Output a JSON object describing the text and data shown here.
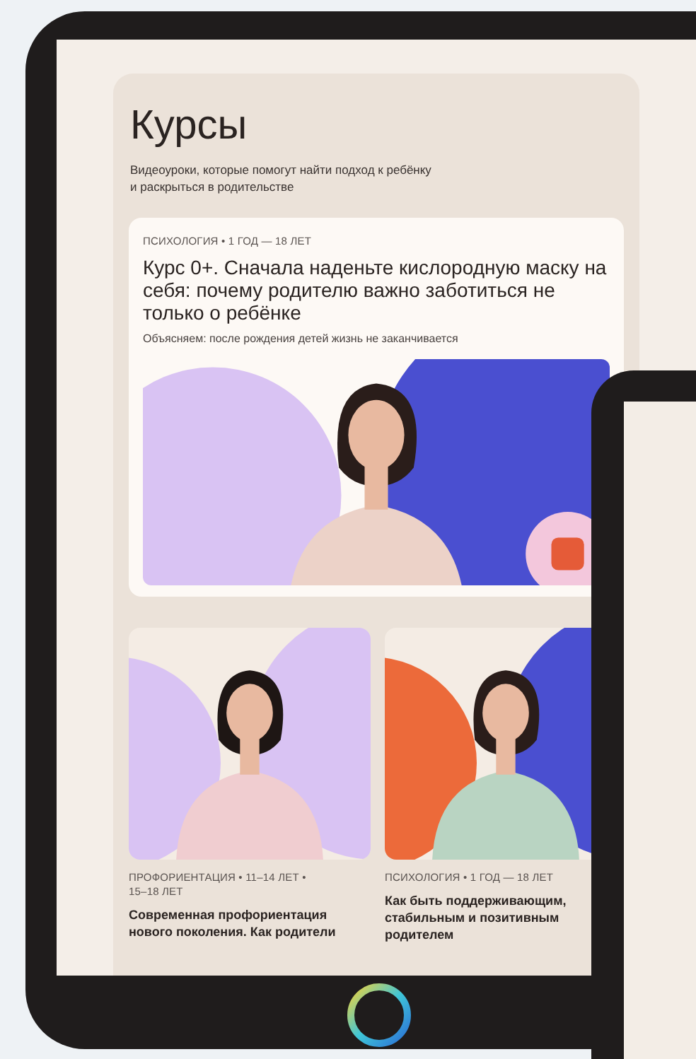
{
  "page": {
    "title": "Курсы",
    "subtitle": "Видеоуроки, которые помогут найти подход к ребёнку\nи раскрыться в родительстве"
  },
  "featured": {
    "tag": "ПСИХОЛОГИЯ • 1 ГОД — 18 ЛЕТ",
    "title": "Курс 0+. Сначала наденьте кислородную маску на себя: почему родителю важно заботиться не только о ребёнке",
    "description": "Объясняем: после рождения детей жизнь не заканчивается"
  },
  "courses": [
    {
      "tag": "ПРОФОРИЕНТАЦИЯ • 11–14 ЛЕТ •\n15–18 ЛЕТ",
      "title": "Современная профориентация\nнового поколения. Как родители"
    },
    {
      "tag": "ПСИХОЛОГИЯ • 1 ГОД — 18 ЛЕТ",
      "title": "Как быть поддерживающим,\nстабильным и позитивным\nродителем"
    }
  ]
}
